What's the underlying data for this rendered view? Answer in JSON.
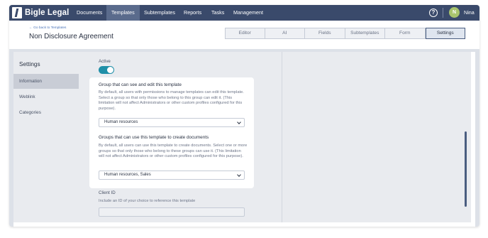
{
  "app": {
    "brand": "Bigle Legal",
    "user_initial": "N",
    "user_name": "Nina",
    "help_glyph": "?"
  },
  "nav": [
    "Documents",
    "Templates",
    "Subtemplates",
    "Reports",
    "Tasks",
    "Management"
  ],
  "header": {
    "back_link": "← Go back to Templates",
    "title": "Non Disclosure Agreement"
  },
  "tabs": [
    "Editor",
    "AI",
    "Fields",
    "Subtemplates",
    "Form",
    "Settings"
  ],
  "active_tab": "Settings",
  "sidebar": {
    "title": "Settings",
    "items": [
      "Information",
      "Weblink",
      "Categories"
    ],
    "active": "Information"
  },
  "settings": {
    "active_label": "Active",
    "active": true,
    "edit_group": {
      "heading": "Group that can see and edit this template",
      "description": "By default, all users with permissions to manage templates can edit this template. Select a group so that only those who belong to this group can edit it. (This limitation will not affect Administrators or other custom profiles configured for this purpose).",
      "value": "Human resources"
    },
    "use_groups": {
      "heading": "Groups that can use this template to create documents",
      "description": "By default, all users can use this template to create documents. Select one or more groups so that only those who belong to these groups can use it. (This limitation will not affect Administrators or other custom profiles configured for this purpose).",
      "value": "Human resources, Sales"
    },
    "client_id": {
      "label": "Client ID",
      "description": "Include an ID of your choice to reference this template",
      "value": ""
    }
  },
  "colors": {
    "nav_bg": "#3a4a6b",
    "toggle_on": "#1f8fa8",
    "avatar": "#a8c46d",
    "link": "#4b74b8"
  },
  "icons": [
    "help-icon",
    "chevron-down-icon"
  ]
}
